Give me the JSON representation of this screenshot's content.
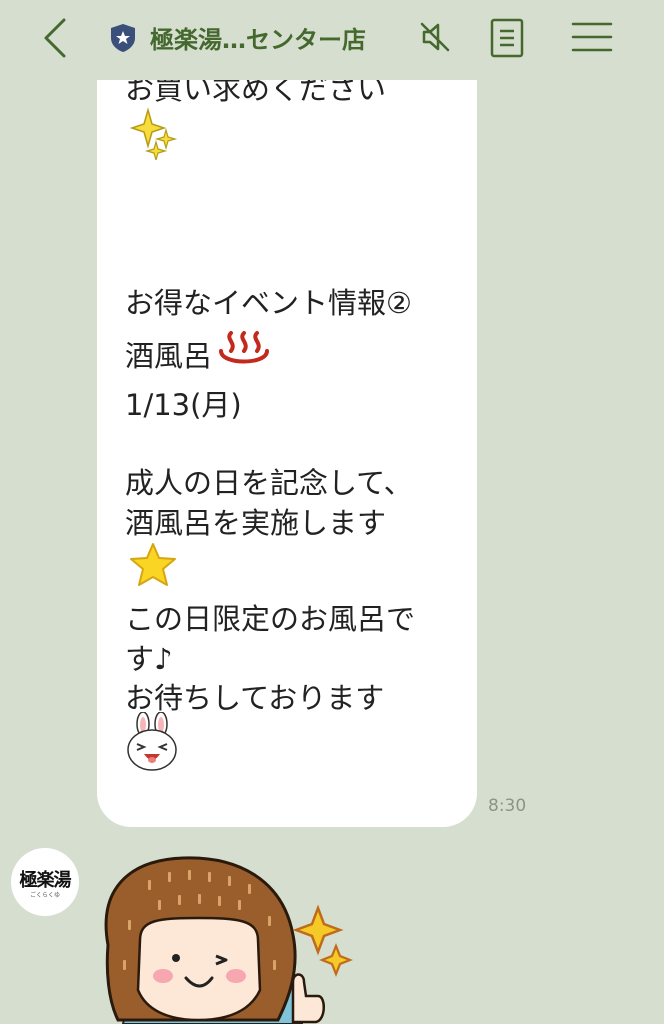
{
  "header": {
    "title": "極楽湯…センター店",
    "icons": [
      "back-icon",
      "official-shield-icon",
      "mute-icon",
      "note-icon",
      "menu-icon"
    ]
  },
  "message": {
    "lines": [
      "お買い求めください",
      "お得なイベント情報②",
      "酒風呂",
      "1/13(月)",
      "成人の日を記念して、",
      "酒風呂を実施します",
      "この日限定のお風呂で",
      "す♪",
      "お待ちしております"
    ],
    "emojis": [
      "sparkles-emoji",
      "hot-springs-emoji",
      "star-emoji",
      "bunny-face-emoji"
    ],
    "time": "8:30"
  },
  "avatar": {
    "label": "極楽湯",
    "sub": "ごくらくゆ"
  },
  "sticker": {
    "name": "girl-wink-thumbs-up-sticker"
  },
  "colors": {
    "background": "#d6dfcf",
    "accent": "#45682f",
    "bubble": "#ffffff"
  }
}
